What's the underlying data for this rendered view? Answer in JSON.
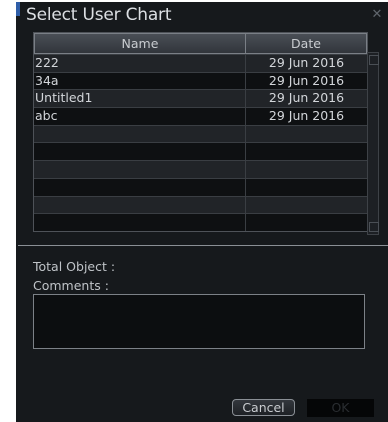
{
  "dialog": {
    "title": "Select User Chart",
    "close_icon": "close-icon"
  },
  "table": {
    "columns": [
      "Name",
      "Date"
    ],
    "rows": [
      {
        "name": "222",
        "date": "29 Jun 2016"
      },
      {
        "name": "34a",
        "date": "29 Jun 2016"
      },
      {
        "name": "Untitled1",
        "date": "29 Jun 2016"
      },
      {
        "name": "abc",
        "date": "29 Jun 2016"
      },
      {
        "name": "",
        "date": ""
      },
      {
        "name": "",
        "date": ""
      },
      {
        "name": "",
        "date": ""
      },
      {
        "name": "",
        "date": ""
      },
      {
        "name": "",
        "date": ""
      },
      {
        "name": "",
        "date": ""
      }
    ]
  },
  "details": {
    "total_object_label": "Total Object :",
    "comments_label": "Comments :",
    "comments_value": ""
  },
  "buttons": {
    "cancel": "Cancel",
    "ok": "OK"
  },
  "colors": {
    "background": "#16191c",
    "accent": "#2f5ea8",
    "text": "#d3d6da"
  }
}
